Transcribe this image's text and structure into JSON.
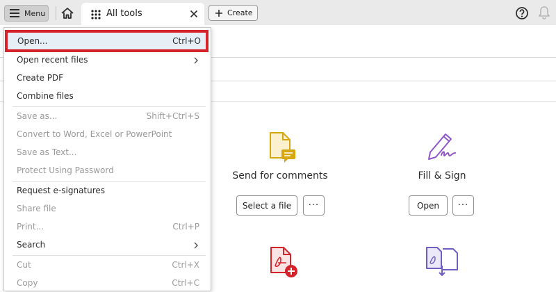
{
  "topbar": {
    "menu_label": "Menu",
    "tab_label": "All tools",
    "create_label": "Create"
  },
  "dropdown": {
    "items": [
      {
        "label": "Open...",
        "shortcut": "Ctrl+O"
      },
      {
        "label": "Open recent files",
        "shortcut": ""
      },
      {
        "label": "Create PDF",
        "shortcut": ""
      },
      {
        "label": "Combine files",
        "shortcut": ""
      },
      {
        "label": "Save as...",
        "shortcut": "Shift+Ctrl+S"
      },
      {
        "label": "Convert to Word, Excel or PowerPoint",
        "shortcut": ""
      },
      {
        "label": "Save as Text...",
        "shortcut": ""
      },
      {
        "label": "Protect Using Password",
        "shortcut": ""
      },
      {
        "label": "Request e-signatures",
        "shortcut": ""
      },
      {
        "label": "Share file",
        "shortcut": ""
      },
      {
        "label": "Print...",
        "shortcut": "Ctrl+P"
      },
      {
        "label": "Search",
        "shortcut": ""
      },
      {
        "label": "Cut",
        "shortcut": "Ctrl+X"
      },
      {
        "label": "Copy",
        "shortcut": "Ctrl+C"
      }
    ]
  },
  "tools": {
    "send_comments": {
      "title": "Send for comments",
      "button": "Select a file",
      "more": "···"
    },
    "fill_sign": {
      "title": "Fill & Sign",
      "button": "Open",
      "more": "···"
    }
  },
  "icons": {
    "menu": "hamburger-icon",
    "home": "home-icon",
    "tab": "grid-icon",
    "close": "close-icon",
    "create": "plus-icon",
    "help": "help-icon",
    "notifications": "bell-icon",
    "submenu": "chevron-right-icon",
    "send_comments": "comment-document-icon",
    "fill_sign": "pen-signature-icon",
    "create_pdf": "pdf-add-icon",
    "compare": "compare-files-icon"
  },
  "colors": {
    "highlight_border": "#d4232a",
    "highlight_bg": "#e6eef6",
    "send_comments_icon": "#d6a70e",
    "fill_sign_icon": "#8f57c9",
    "create_pdf_icon": "#d4232a",
    "compare_icon": "#6e5fc7"
  }
}
